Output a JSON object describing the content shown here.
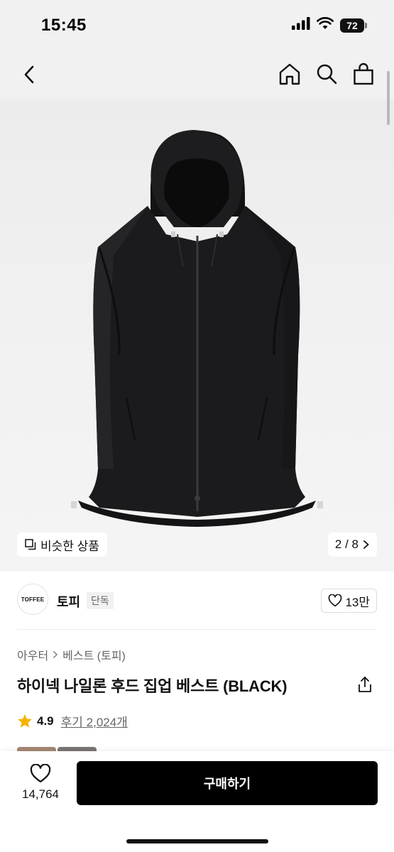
{
  "status_bar": {
    "time": "15:45",
    "battery": "72",
    "icons": [
      "signal-icon",
      "wifi-icon",
      "battery-icon"
    ]
  },
  "nav": {
    "icons": [
      "back-icon",
      "home-icon",
      "search-icon",
      "shopping-bag-icon"
    ]
  },
  "gallery": {
    "similar_label": "비슷한 상품",
    "page_indicator": "2 / 8"
  },
  "brand": {
    "logo_text": "TOFFEE",
    "name": "토피",
    "badge": "단독",
    "likes": "13만"
  },
  "product": {
    "breadcrumb": [
      "아우터",
      "베스트 (토피)"
    ],
    "title": "하이넥 나일론 후드 집업 베스트 (BLACK)",
    "rating": "4.9",
    "reviews": "후기 2,024개"
  },
  "bottom_bar": {
    "wish_count": "14,764",
    "buy_label": "구매하기"
  },
  "colors": {
    "accent_star": "#f5b400",
    "buy_button": "#000000",
    "background_header": "#f1f1f1"
  }
}
